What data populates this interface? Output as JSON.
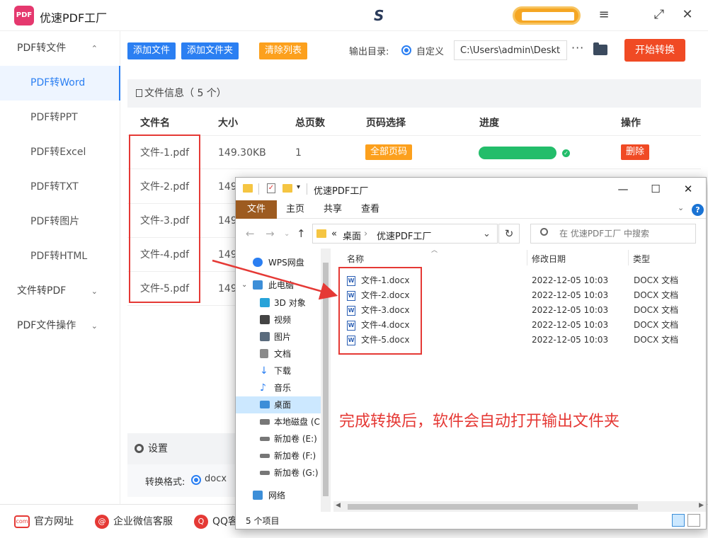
{
  "app": {
    "title": "优速PDF工厂",
    "logo_text": "PDF",
    "brand_mark": "S"
  },
  "window_controls": [
    "≡",
    "⤢",
    "✕"
  ],
  "sidebar": {
    "groups": [
      {
        "label": "PDF转文件",
        "chevron": "⌃"
      },
      {
        "label": "文件转PDF",
        "chevron": "⌄"
      },
      {
        "label": "PDF文件操作",
        "chevron": "⌄"
      }
    ],
    "items": [
      "PDF转Word",
      "PDF转PPT",
      "PDF转Excel",
      "PDF转TXT",
      "PDF转图片",
      "PDF转HTML"
    ]
  },
  "toolbar": {
    "add_file": "添加文件",
    "add_folder": "添加文件夹",
    "clear_list": "清除列表",
    "output_label": "输出目录:",
    "custom_label": "自定义",
    "output_path": "C:\\Users\\admin\\Deskto",
    "more": "···",
    "start": "开始转换"
  },
  "file_info": {
    "header": "文件信息（ 5 个）",
    "columns": [
      "文件名",
      "大小",
      "总页数",
      "页码选择",
      "进度",
      "操作"
    ],
    "rows": [
      {
        "name": "文件-1.pdf",
        "size": "149.30KB",
        "pages": "1",
        "page_select": "全部页码",
        "progress": 1.0,
        "action": "删除"
      },
      {
        "name": "文件-2.pdf",
        "size": "149."
      },
      {
        "name": "文件-3.pdf",
        "size": "149."
      },
      {
        "name": "文件-4.pdf",
        "size": "149."
      },
      {
        "name": "文件-5.pdf",
        "size": "149."
      }
    ]
  },
  "settings": {
    "title": "设置",
    "format_label": "转换格式:",
    "format_value": "docx"
  },
  "footer": [
    {
      "label": "官方网址",
      "icon": "com"
    },
    {
      "label": "企业微信客服",
      "icon": "@"
    },
    {
      "label": "QQ客",
      "icon": "Q"
    }
  ],
  "explorer": {
    "title": "优速PDF工厂",
    "controls": [
      "—",
      "☐",
      "✕"
    ],
    "ribbon_tabs": [
      "文件",
      "主页",
      "共享",
      "查看"
    ],
    "help": "?",
    "address": {
      "prefix": "«",
      "segments": [
        "桌面",
        "优速PDF工厂"
      ]
    },
    "search_placeholder": "在 优速PDF工厂 中搜索",
    "tree": [
      {
        "label": "WPS网盘",
        "color": "#2b7ff2"
      },
      {
        "label": "此电脑",
        "color": "#3c8ed8"
      },
      {
        "label": "3D 对象",
        "color": "#27a3d9"
      },
      {
        "label": "视频",
        "color": "#444444"
      },
      {
        "label": "图片",
        "color": "#5a6b7d"
      },
      {
        "label": "文档",
        "color": "#8a8a8a"
      },
      {
        "label": "下载",
        "color": "#2b7ff2"
      },
      {
        "label": "音乐",
        "color": "#2b7ff2"
      },
      {
        "label": "桌面",
        "color": "#3c8ed8"
      },
      {
        "label": "本地磁盘 (C",
        "color": "#777777"
      },
      {
        "label": "新加卷 (E:)",
        "color": "#777777"
      },
      {
        "label": "新加卷 (F:)",
        "color": "#777777"
      },
      {
        "label": "新加卷 (G:)",
        "color": "#777777"
      },
      {
        "label": "网络",
        "color": "#3c8ed8"
      }
    ],
    "list_columns": [
      "名称",
      "修改日期",
      "类型"
    ],
    "files": [
      {
        "name": "文件-1.docx",
        "date": "2022-12-05 10:03",
        "type": "DOCX 文档"
      },
      {
        "name": "文件-2.docx",
        "date": "2022-12-05 10:03",
        "type": "DOCX 文档"
      },
      {
        "name": "文件-3.docx",
        "date": "2022-12-05 10:03",
        "type": "DOCX 文档"
      },
      {
        "name": "文件-4.docx",
        "date": "2022-12-05 10:03",
        "type": "DOCX 文档"
      },
      {
        "name": "文件-5.docx",
        "date": "2022-12-05 10:03",
        "type": "DOCX 文档"
      }
    ],
    "hint": "完成转换后，软件会自动打开输出文件夹",
    "status": "5 个项目"
  },
  "colors": {
    "accent": "#2b7ff2",
    "warning": "#fca01d",
    "danger": "#f04a24",
    "success": "#23bd6a",
    "annotation": "#e53935"
  }
}
